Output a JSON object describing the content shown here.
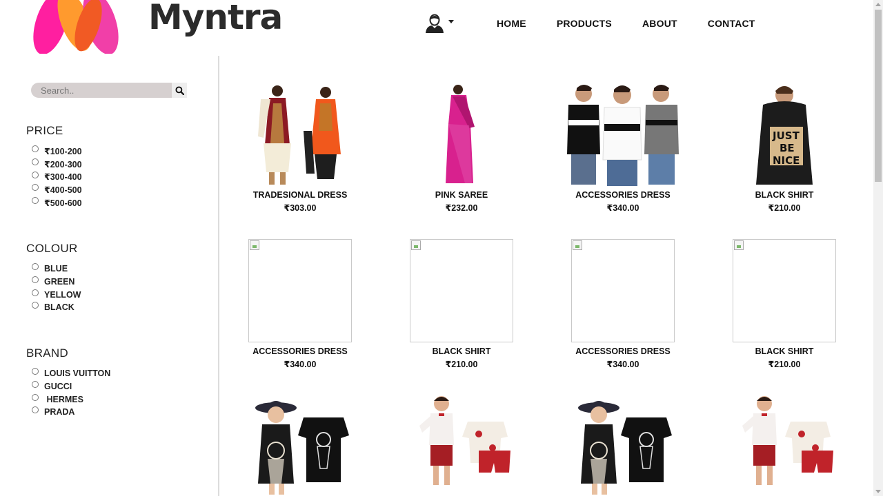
{
  "brand": {
    "name": "Myntra"
  },
  "nav": {
    "items": [
      "HOME",
      "PRODUCTS",
      "ABOUT",
      "CONTACT"
    ]
  },
  "search": {
    "placeholder": "Search.."
  },
  "filters": {
    "price": {
      "title": "PRICE",
      "options": [
        "₹100-200",
        "₹200-300",
        "₹300-400",
        "₹400-500",
        "₹500-600"
      ]
    },
    "colour": {
      "title": "COLOUR",
      "options": [
        "BLUE",
        "GREEN",
        "YELLOW",
        "BLACK"
      ]
    },
    "brand": {
      "title": "BRAND",
      "options": [
        "LOUIS VUITTON",
        "GUCCI",
        " HERMES",
        "PRADA"
      ]
    }
  },
  "products": [
    {
      "name": "TRADESIONAL DRESS",
      "price": "₹303.00",
      "image": "traditional-dress"
    },
    {
      "name": "PINK SAREE",
      "price": "₹232.00",
      "image": "pink-saree"
    },
    {
      "name": "ACCESSORIES DRESS",
      "price": "₹340.00",
      "image": "three-tshirts"
    },
    {
      "name": "BLACK SHIRT",
      "price": "₹210.00",
      "image": "black-hoodie"
    },
    {
      "name": "ACCESSORIES DRESS",
      "price": "₹340.00",
      "image": "broken"
    },
    {
      "name": "BLACK SHIRT",
      "price": "₹210.00",
      "image": "broken"
    },
    {
      "name": "ACCESSORIES DRESS",
      "price": "₹340.00",
      "image": "broken"
    },
    {
      "name": "BLACK SHIRT",
      "price": "₹210.00",
      "image": "broken"
    },
    {
      "name": "",
      "price": "",
      "image": "girl-dress"
    },
    {
      "name": "",
      "price": "",
      "image": "boy-outfit"
    },
    {
      "name": "",
      "price": "",
      "image": "girl-dress"
    },
    {
      "name": "",
      "price": "",
      "image": "boy-outfit"
    }
  ],
  "colors": {
    "logo_pink": "#e91e8c",
    "logo_orange": "#f7931e",
    "logo_red": "#f15a24"
  }
}
